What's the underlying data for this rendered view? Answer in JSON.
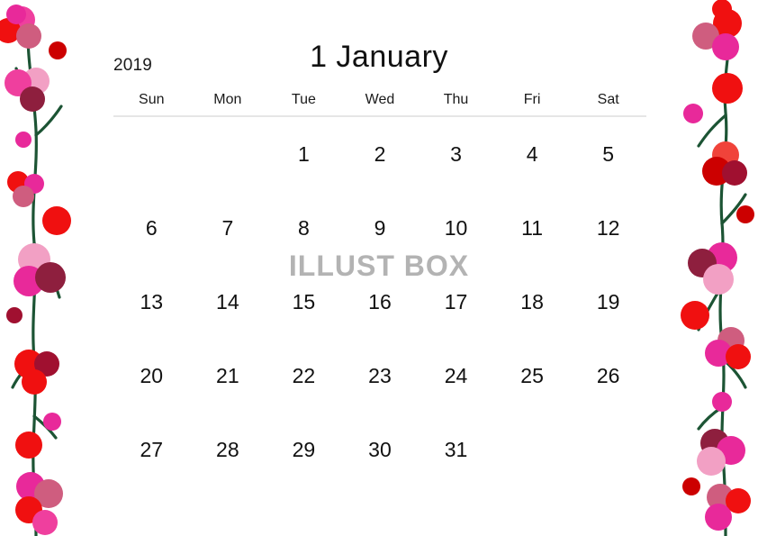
{
  "calendar": {
    "year": "2019",
    "month_title": "1 January",
    "weekday_headers": [
      {
        "label": "Sun",
        "kind": "sun"
      },
      {
        "label": "Mon",
        "kind": "norm"
      },
      {
        "label": "Tue",
        "kind": "norm"
      },
      {
        "label": "Wed",
        "kind": "norm"
      },
      {
        "label": "Thu",
        "kind": "norm"
      },
      {
        "label": "Fri",
        "kind": "norm"
      },
      {
        "label": "Sat",
        "kind": "sat"
      }
    ],
    "weeks": [
      [
        {
          "day": "",
          "kind": "empty"
        },
        {
          "day": "",
          "kind": "empty"
        },
        {
          "day": "1",
          "kind": "hol"
        },
        {
          "day": "2",
          "kind": "norm"
        },
        {
          "day": "3",
          "kind": "norm"
        },
        {
          "day": "4",
          "kind": "norm"
        },
        {
          "day": "5",
          "kind": "sat"
        }
      ],
      [
        {
          "day": "6",
          "kind": "sun"
        },
        {
          "day": "7",
          "kind": "norm"
        },
        {
          "day": "8",
          "kind": "norm"
        },
        {
          "day": "9",
          "kind": "norm"
        },
        {
          "day": "10",
          "kind": "norm"
        },
        {
          "day": "11",
          "kind": "norm"
        },
        {
          "day": "12",
          "kind": "sat"
        }
      ],
      [
        {
          "day": "13",
          "kind": "sun"
        },
        {
          "day": "14",
          "kind": "hol"
        },
        {
          "day": "15",
          "kind": "norm"
        },
        {
          "day": "16",
          "kind": "norm"
        },
        {
          "day": "17",
          "kind": "norm"
        },
        {
          "day": "18",
          "kind": "norm"
        },
        {
          "day": "19",
          "kind": "sat"
        }
      ],
      [
        {
          "day": "20",
          "kind": "sun"
        },
        {
          "day": "21",
          "kind": "norm"
        },
        {
          "day": "22",
          "kind": "norm"
        },
        {
          "day": "23",
          "kind": "norm"
        },
        {
          "day": "24",
          "kind": "norm"
        },
        {
          "day": "25",
          "kind": "norm"
        },
        {
          "day": "26",
          "kind": "sat"
        }
      ],
      [
        {
          "day": "27",
          "kind": "sun"
        },
        {
          "day": "28",
          "kind": "norm"
        },
        {
          "day": "29",
          "kind": "norm"
        },
        {
          "day": "30",
          "kind": "norm"
        },
        {
          "day": "31",
          "kind": "norm"
        },
        {
          "day": "",
          "kind": "empty"
        },
        {
          "day": "",
          "kind": "empty"
        }
      ]
    ]
  },
  "watermark": {
    "text": "ILLUST BOX"
  },
  "colors": {
    "sunday": "#b01c1c",
    "saturday": "#1a7fc1",
    "holiday": "#b01c1c",
    "weekday": "#111111",
    "header_sun": "#a13a36",
    "header_sat": "#2d8fc4",
    "divider": "#e6e6e6",
    "watermark": "#b3b3b3",
    "background": "#ffffff",
    "vine_stem": "#1c5434",
    "berry_red": "#f01010",
    "berry_crimson": "#cc0000",
    "berry_darkred": "#a01030",
    "berry_magenta": "#e8299a",
    "berry_pink": "#ef7fb8",
    "berry_lightpink": "#f2a0c4",
    "berry_dustyrose": "#cf5d7f",
    "berry_wine": "#8e1f3e"
  },
  "decorations": {
    "left_border_name": "berry-vine-left",
    "right_border_name": "berry-vine-right"
  }
}
